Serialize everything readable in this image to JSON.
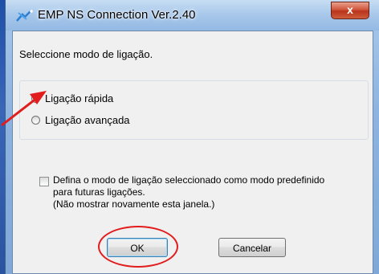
{
  "window": {
    "title": "EMP NS Connection Ver.2.40",
    "close_glyph": "x"
  },
  "prompt": "Seleccione modo de ligação.",
  "connection_modes": [
    {
      "label": "Ligação rápida",
      "selected": true
    },
    {
      "label": "Ligação avançada",
      "selected": false
    }
  ],
  "default_option": {
    "checked": false,
    "lines": [
      "Defina o modo de ligação seleccionado como modo predefinido",
      "para futuras ligações.",
      "(Não mostrar novamente esta janela.)"
    ]
  },
  "buttons": {
    "ok": "OK",
    "cancel": "Cancelar"
  },
  "annotation_color": "#e11d1d",
  "icons": {
    "app": "network-connection-icon",
    "close": "close-icon"
  }
}
